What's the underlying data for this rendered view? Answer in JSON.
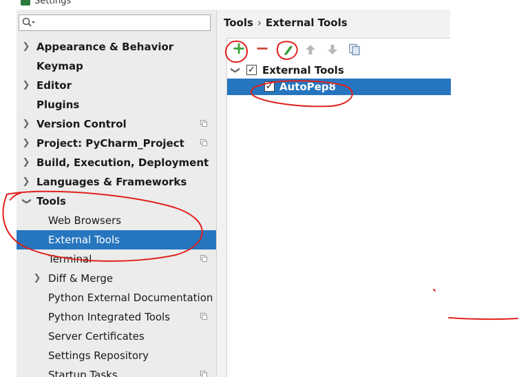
{
  "window": {
    "title": "Settings"
  },
  "search": {
    "placeholder": "",
    "value": ""
  },
  "sidebar": {
    "items": [
      {
        "label": "Appearance & Behavior",
        "expanded": false
      },
      {
        "label": "Keymap"
      },
      {
        "label": "Editor",
        "expanded": false
      },
      {
        "label": "Plugins"
      },
      {
        "label": "Version Control",
        "expanded": false
      },
      {
        "label": "Project: PyCharm_Project",
        "expanded": false
      },
      {
        "label": "Build, Execution, Deployment",
        "expanded": false
      },
      {
        "label": "Languages & Frameworks",
        "expanded": false
      },
      {
        "label": "Tools",
        "expanded": true
      }
    ],
    "tools_children": [
      {
        "label": "Web Browsers"
      },
      {
        "label": "External Tools",
        "selected": true
      },
      {
        "label": "Terminal"
      },
      {
        "label": "Diff & Merge",
        "expanded": false
      },
      {
        "label": "Python External Documentation"
      },
      {
        "label": "Python Integrated Tools"
      },
      {
        "label": "Server Certificates"
      },
      {
        "label": "Settings Repository"
      },
      {
        "label": "Startup Tasks"
      }
    ]
  },
  "breadcrumb": {
    "parent": "Tools",
    "separator": "›",
    "current": "External Tools"
  },
  "toolbar": {
    "add_icon": "plus-icon",
    "remove_icon": "minus-icon",
    "edit_icon": "pencil-icon",
    "up_icon": "arrow-up-icon",
    "down_icon": "arrow-down-icon",
    "copy_icon": "copy-icon"
  },
  "tools_tree": {
    "group": {
      "label": "External Tools",
      "checked": true
    },
    "items": [
      {
        "label": "AutoPep8",
        "checked": true,
        "selected": true
      }
    ]
  },
  "colors": {
    "selection": "#2675bf",
    "annotation": "#e0201c",
    "add": "#3aa33a",
    "remove": "#d24a3a"
  }
}
